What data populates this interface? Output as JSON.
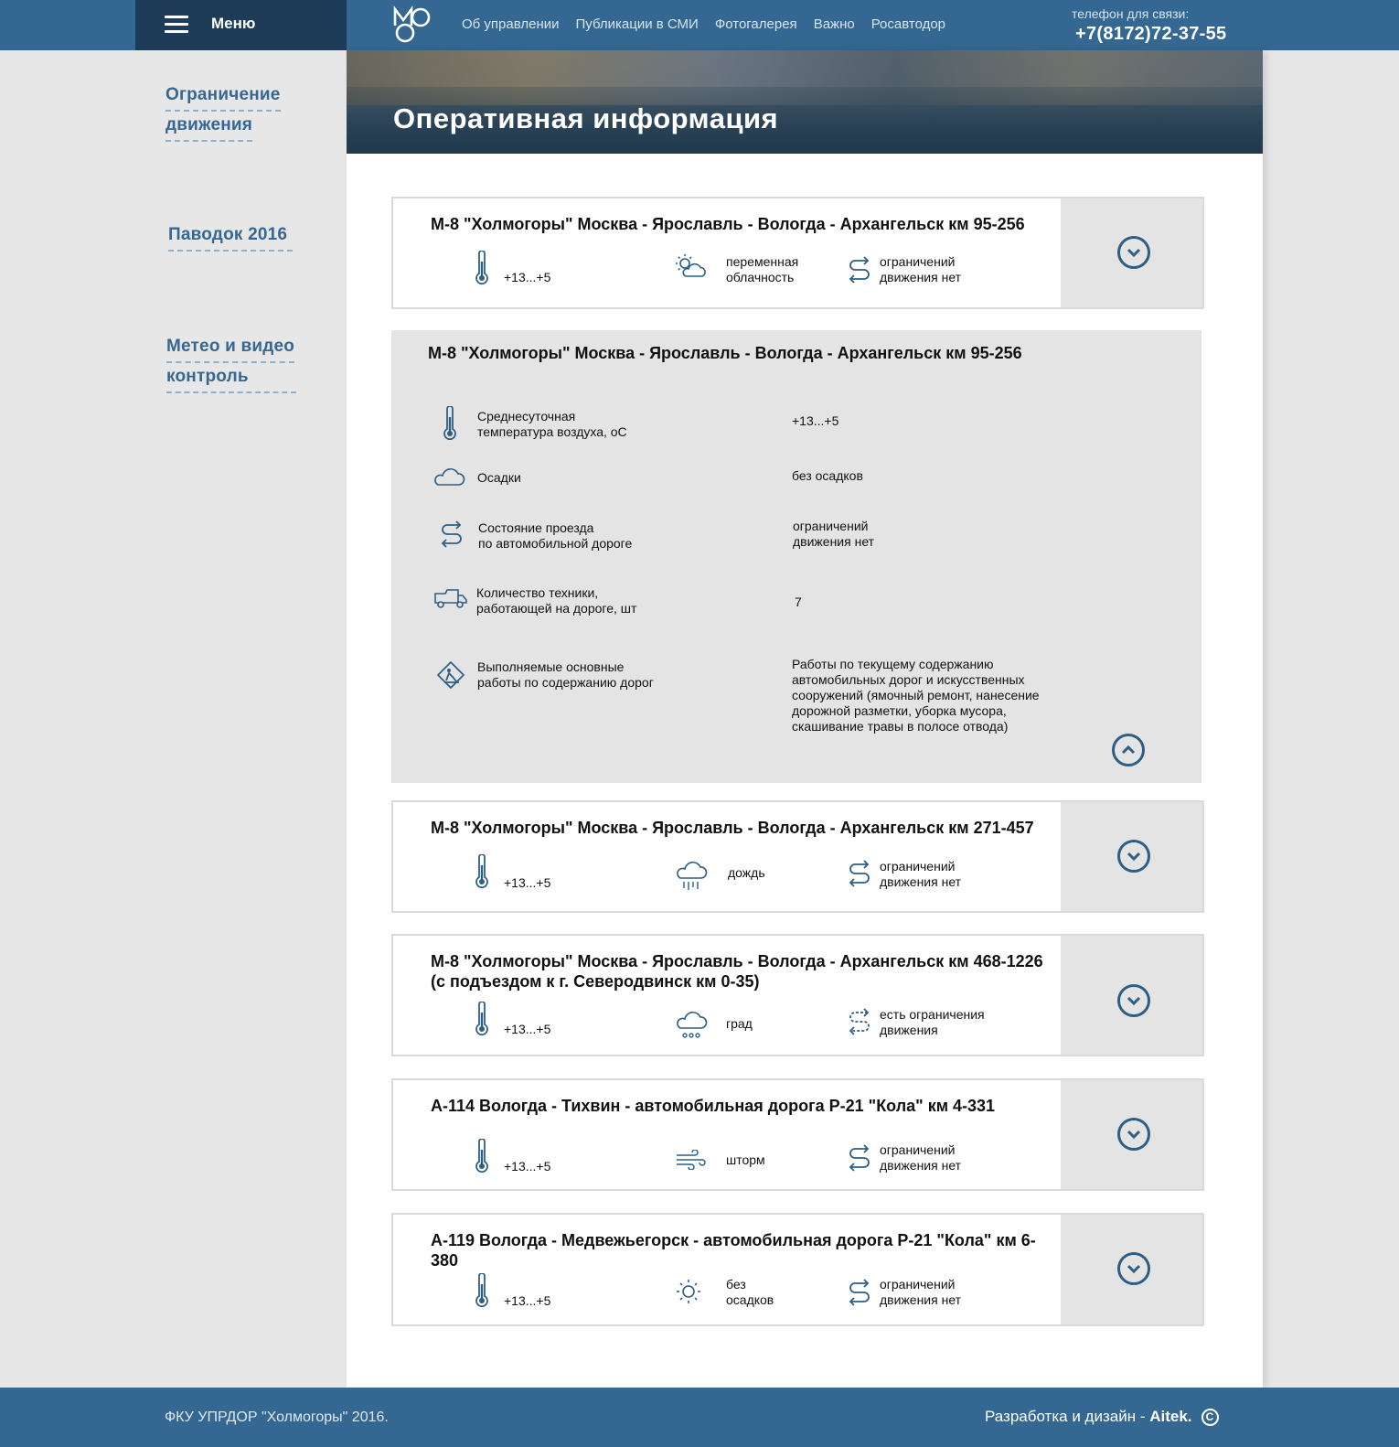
{
  "header": {
    "menu_label": "Меню",
    "nav": [
      "Об управлении",
      "Публикации в СМИ",
      "Фотогалерея",
      "Важно",
      "Росавтодор"
    ],
    "phone_caption": "телефон для связи:",
    "phone": "+7(8172)72-37-55"
  },
  "sidebar": {
    "items": [
      {
        "line1": "Ограничение",
        "line2": "движения"
      },
      {
        "line1": "Паводок 2016"
      },
      {
        "line1": "Метео и видео",
        "line2": "контроль"
      }
    ]
  },
  "page_title": "Оперативная информация",
  "cards": [
    {
      "title": "М-8 \"Холмогоры\" Москва - Ярославль - Вологда - Архангельск км 95-256",
      "temp": "+13...+5",
      "weather_l1": "переменная",
      "weather_l2": "облачность",
      "weather_icon": "partly-cloudy-icon",
      "traffic_l1": "ограничений",
      "traffic_l2": "движения нет"
    },
    {
      "title": "М-8 \"Холмогоры\" Москва - Ярославль - Вологда - Архангельск км 271-457",
      "temp": "+13...+5",
      "weather_l1": "дождь",
      "weather_icon": "rain-icon",
      "traffic_l1": "ограничений",
      "traffic_l2": "движения нет"
    },
    {
      "title": "М-8 \"Холмогоры\" Москва - Ярославль - Вологда - Архангельск км 468-1226 (с подъездом к г. Северодвинск км 0-35)",
      "temp": "+13...+5",
      "weather_l1": "град",
      "weather_icon": "hail-icon",
      "traffic_l1": "есть ограничения",
      "traffic_l2": "движения"
    },
    {
      "title": "А-114 Вологда - Тихвин - автомобильная дорога Р-21 \"Кола\" км 4-331",
      "temp": "+13...+5",
      "weather_l1": "шторм",
      "weather_icon": "wind-icon",
      "traffic_l1": "ограничений",
      "traffic_l2": "движения нет"
    },
    {
      "title": "А-119 Вологда - Медвежьегорск - автомобильная дорога Р-21 \"Кола\" км 6-380",
      "temp": "+13...+5",
      "weather_l1": "без",
      "weather_l2": "осадков",
      "weather_icon": "sun-icon",
      "traffic_l1": "ограничений",
      "traffic_l2": "движения нет"
    }
  ],
  "expanded": {
    "title": "М-8 \"Холмогоры\" Москва - Ярославль - Вологда - Архангельск км 95-256",
    "rows": [
      {
        "icon": "thermometer-icon",
        "label_l1": "Среднесуточная",
        "label_l2": "температура воздуха, оС",
        "value": "+13...+5"
      },
      {
        "icon": "cloud-icon",
        "label_l1": "Осадки",
        "value": "без осадков"
      },
      {
        "icon": "road-status-icon",
        "label_l1": "Состояние проезда",
        "label_l2": "по автомобильной дороге",
        "value_l1": "ограничений",
        "value_l2": "движения нет"
      },
      {
        "icon": "truck-icon",
        "label_l1": "Количество техники,",
        "label_l2": "работающей на дороге, шт",
        "value": "7"
      },
      {
        "icon": "roadwork-icon",
        "label_l1": "Выполняемые основные",
        "label_l2": "работы по содержанию дорог",
        "value_lines": [
          "Работы по текущему содержанию",
          "автомобильных дорог и искусственных",
          "сооружений (ямочный ремонт, нанесение",
          "дорожной разметки, уборка мусора,",
          "скашивание травы в полосе отвода)"
        ]
      }
    ]
  },
  "footer": {
    "left": "ФКУ УПРДОР \"Холмогоры\" 2016.",
    "right_prefix": "Разработка и дизайн - ",
    "right_brand": "Aitek.",
    "copyright_symbol": "C"
  },
  "colors": {
    "accent": "#346892",
    "dark": "#1e3b57",
    "icon": "#2d5f86"
  }
}
